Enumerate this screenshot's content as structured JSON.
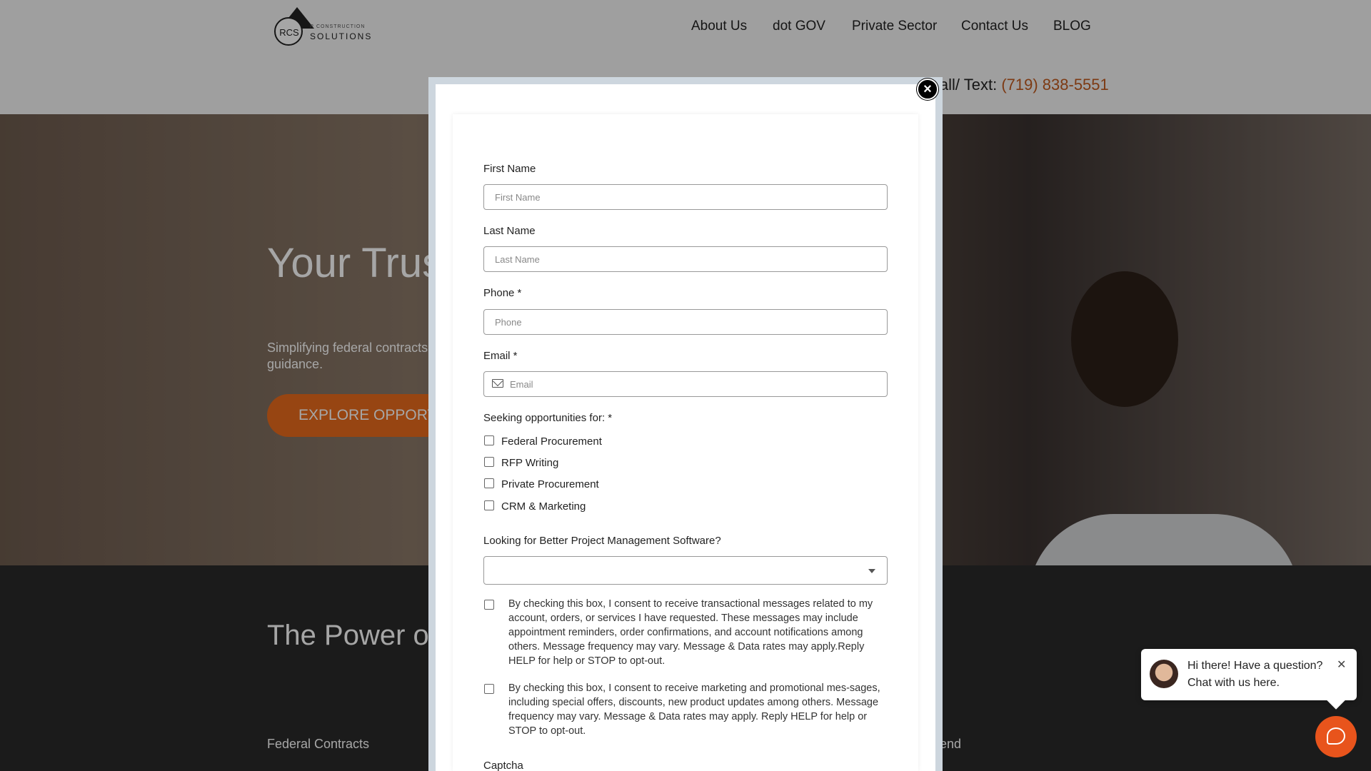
{
  "header": {
    "logo_initials": "RCS",
    "logo_tagline": "R CONSTRUCTION",
    "logo_name": "SOLUTIONS",
    "nav": [
      "About Us",
      "dot GOV",
      "Private Sector",
      "Contact Us",
      "BLOG"
    ],
    "call_label": "Call/ Text:",
    "call_phone": "(719) 838-5551"
  },
  "hero": {
    "title_visible": "Your Trus Federal P",
    "subtitle_visible": "Simplifying federal contracts guidance.",
    "button_visible": "EXPLORE OPPORT"
  },
  "section": {
    "title_visible": "The Power of Public and Pr",
    "tab_left": "Federal Contracts",
    "tab_right_visible": "end"
  },
  "modal": {
    "close_symbol": "×",
    "fields": [
      {
        "label": "First Name",
        "placeholder": "First Name"
      },
      {
        "label": "Last Name",
        "placeholder": "Last Name"
      },
      {
        "label": "Phone *",
        "placeholder": "Phone"
      },
      {
        "label": "Email *",
        "placeholder": "Email"
      }
    ],
    "seeking_label": "Seeking opportunities for: *",
    "options": [
      "Federal Procurement",
      "RFP Writing",
      "Private Procurement",
      "CRM & Marketing"
    ],
    "software_label": "Looking for Better Project Management Software?",
    "software_selected": "",
    "consent_transactional": "By checking this box, I consent to receive transactional messages related to my account, orders, or services I have requested. These messages may include appointment reminders, order confirmations, and account notifications among others. Message frequency may vary. Message & Data rates may apply.Reply HELP for help or STOP to opt-out.",
    "consent_marketing": "By checking this box, I consent to receive marketing and promotional mes-sages, including special offers, discounts, new product updates among others. Message frequency may vary. Message & Data rates may apply. Reply HELP for help or STOP to opt-out.",
    "captcha_label": "Captcha"
  },
  "chat": {
    "message": "Hi there! Have a question? Chat with us here.",
    "close_symbol": "✕"
  },
  "colors": {
    "accent": "#e8541c",
    "phone": "#c05a1e"
  }
}
